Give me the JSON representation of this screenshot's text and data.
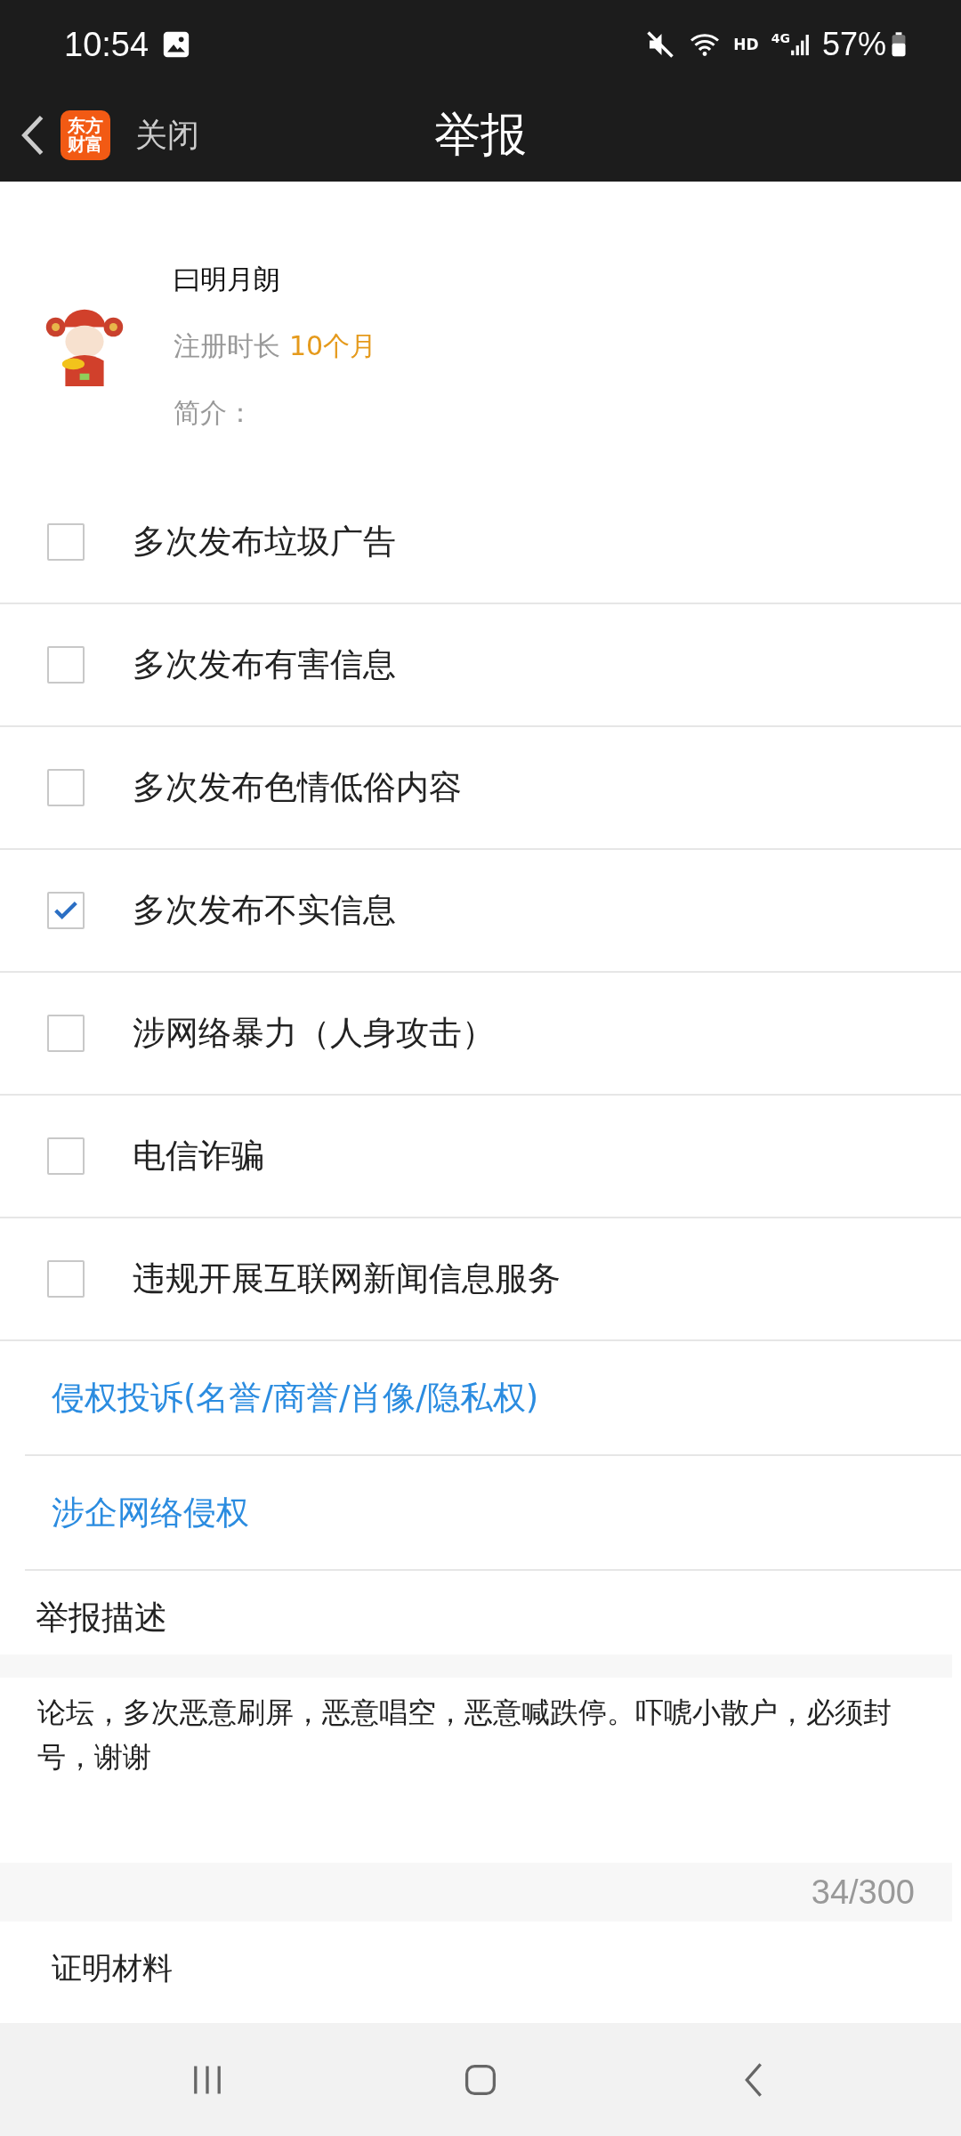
{
  "status_bar": {
    "time": "10:54",
    "network": "HD",
    "signal": "4G",
    "battery": "57%"
  },
  "app_bar": {
    "logo_lines": [
      "东方",
      "财富"
    ],
    "close": "关闭",
    "title": "举报"
  },
  "profile": {
    "name": "曰明月朗",
    "tenure_label": "注册时长",
    "tenure_value": "10个月",
    "intro_label": "简介："
  },
  "reasons": [
    {
      "label": "多次发布垃圾广告",
      "checked": false
    },
    {
      "label": "多次发布有害信息",
      "checked": false
    },
    {
      "label": "多次发布色情低俗内容",
      "checked": false
    },
    {
      "label": "多次发布不实信息",
      "checked": true
    },
    {
      "label": "涉网络暴力（人身攻击）",
      "checked": false
    },
    {
      "label": "电信诈骗",
      "checked": false
    },
    {
      "label": "违规开展互联网新闻信息服务",
      "checked": false
    }
  ],
  "links": [
    "侵权投诉(名誉/商誉/肖像/隐私权)",
    "涉企网络侵权"
  ],
  "description": {
    "label": "举报描述",
    "value": "论坛，多次恶意刷屏，恶意唱空，恶意喊跌停。吓唬小散户，必须封号，谢谢",
    "counter": "34/300"
  },
  "evidence": {
    "label": "证明材料"
  }
}
